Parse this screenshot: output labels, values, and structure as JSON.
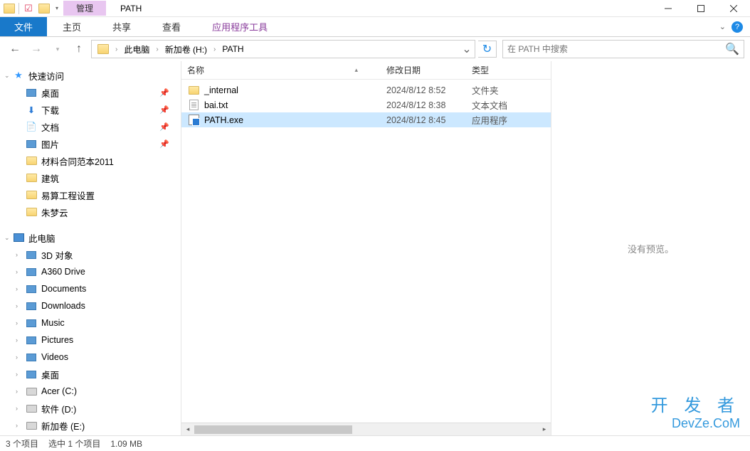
{
  "window": {
    "manage_tab": "管理",
    "title": "PATH",
    "tool_tab": "应用程序工具"
  },
  "ribbon": {
    "file": "文件",
    "tabs": [
      "主页",
      "共享",
      "查看"
    ]
  },
  "breadcrumb": {
    "items": [
      "此电脑",
      "新加卷 (H:)",
      "PATH"
    ]
  },
  "search": {
    "placeholder": "在 PATH 中搜索"
  },
  "tree": {
    "quick_access": "快速访问",
    "pinned": [
      {
        "label": "桌面",
        "icon": "desktop"
      },
      {
        "label": "下载",
        "icon": "download"
      },
      {
        "label": "文档",
        "icon": "document"
      },
      {
        "label": "图片",
        "icon": "picture"
      }
    ],
    "folders": [
      "材料合同范本2011",
      "建筑",
      "易算工程设置",
      "朱梦云"
    ],
    "this_pc": "此电脑",
    "pc_items": [
      {
        "label": "3D 对象"
      },
      {
        "label": "A360 Drive"
      },
      {
        "label": "Documents"
      },
      {
        "label": "Downloads"
      },
      {
        "label": "Music"
      },
      {
        "label": "Pictures"
      },
      {
        "label": "Videos"
      },
      {
        "label": "桌面"
      },
      {
        "label": "Acer (C:)"
      },
      {
        "label": "软件 (D:)"
      },
      {
        "label": "新加卷 (E:)"
      }
    ]
  },
  "columns": {
    "name": "名称",
    "date": "修改日期",
    "type": "类型"
  },
  "files": [
    {
      "name": "_internal",
      "date": "2024/8/12 8:52",
      "type": "文件夹",
      "icon": "folder",
      "selected": false
    },
    {
      "name": "bai.txt",
      "date": "2024/8/12 8:38",
      "type": "文本文档",
      "icon": "txt",
      "selected": false
    },
    {
      "name": "PATH.exe",
      "date": "2024/8/12 8:45",
      "type": "应用程序",
      "icon": "exe",
      "selected": true
    }
  ],
  "preview": {
    "none": "没有预览。"
  },
  "status": {
    "count": "3 个项目",
    "selected": "选中 1 个项目",
    "size": "1.09 MB"
  },
  "watermark": {
    "line1": "开 发 者",
    "line2": "DevZe.CoM"
  }
}
